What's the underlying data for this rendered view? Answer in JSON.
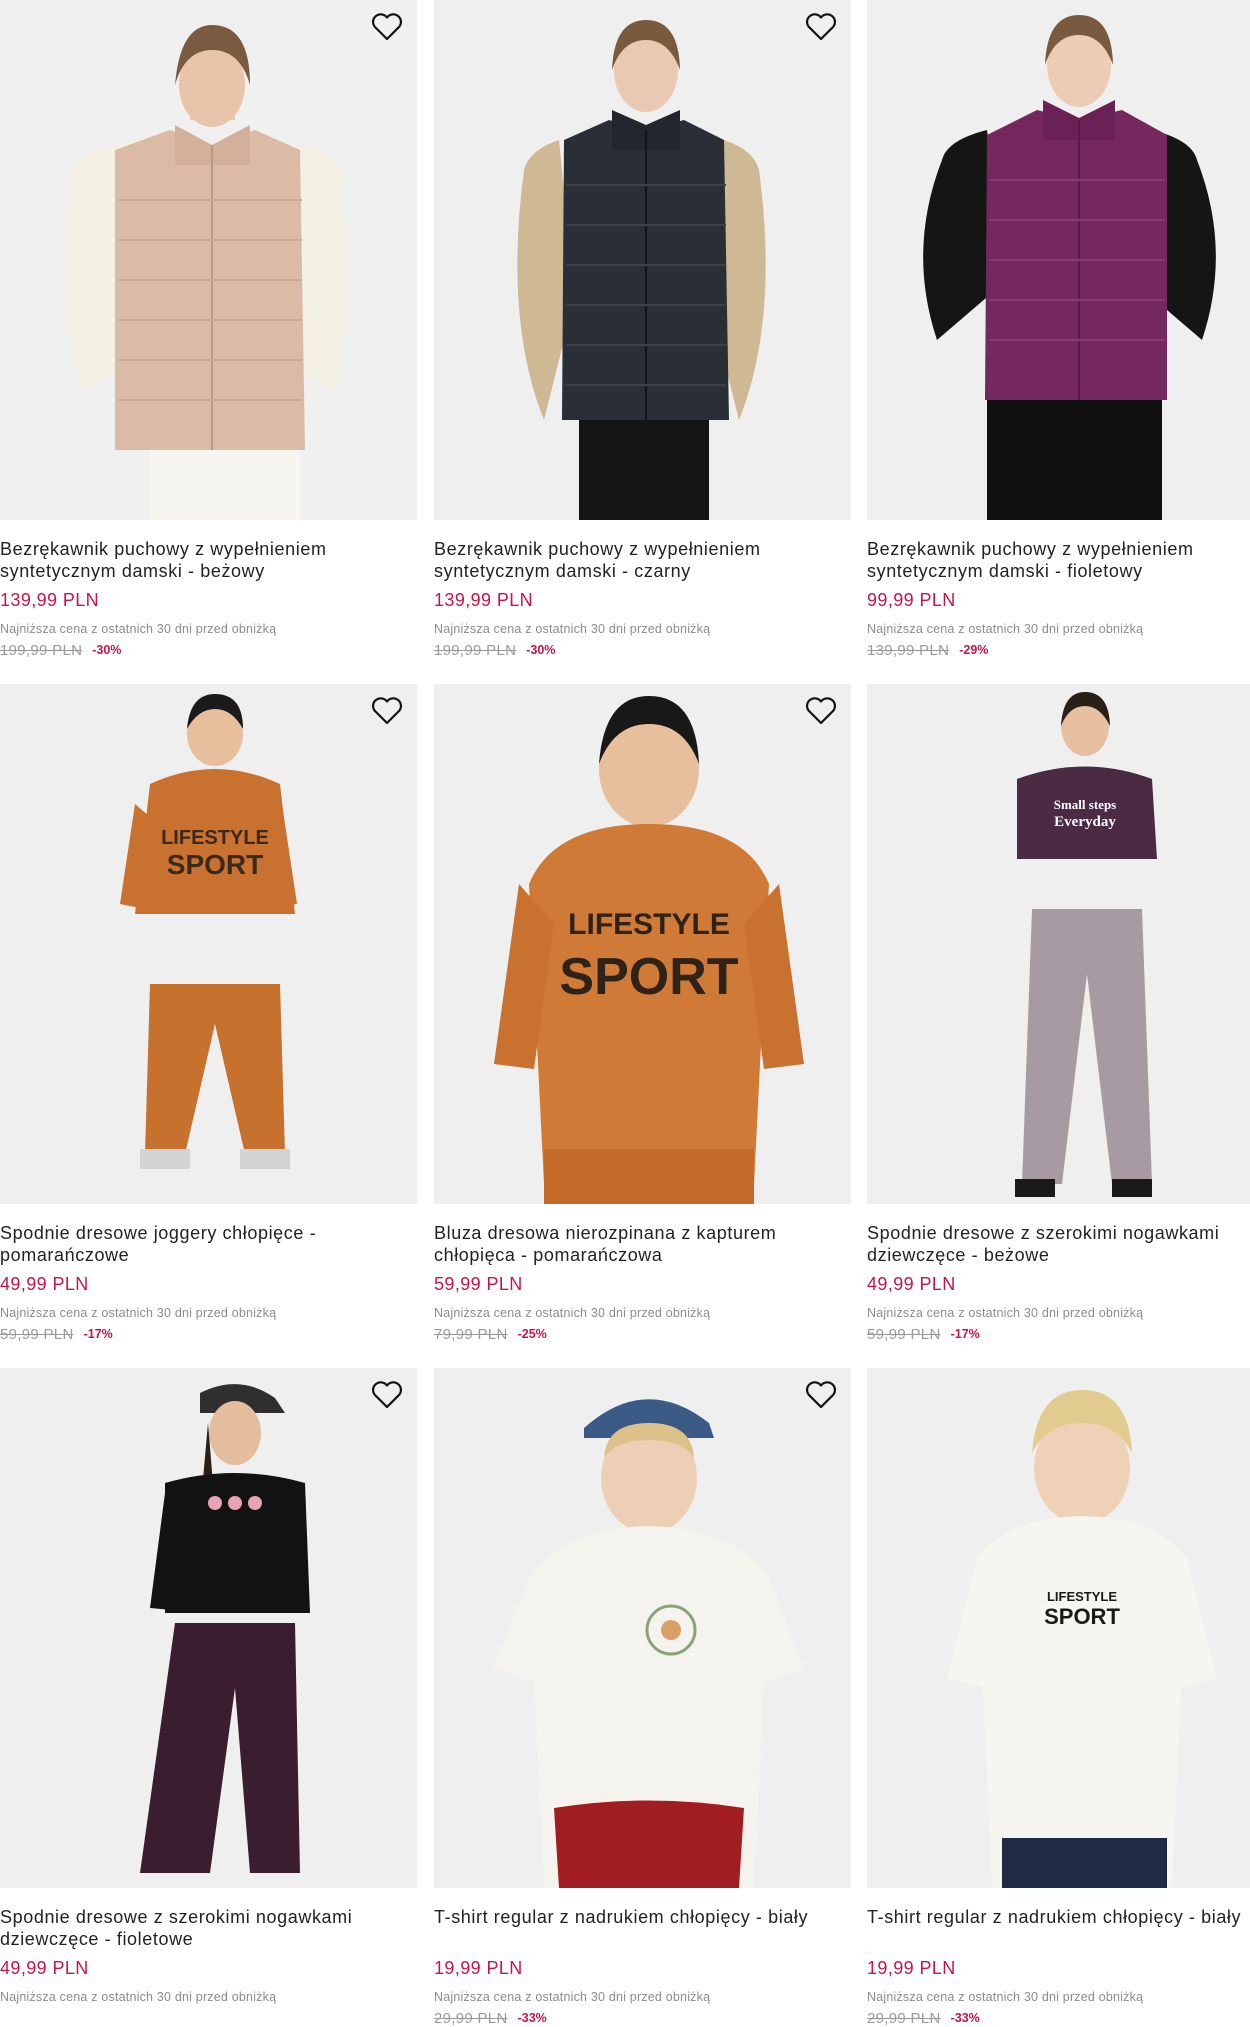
{
  "colors": {
    "accent": "#c4164d",
    "muted": "#8c8c8c",
    "text": "#222222"
  },
  "products": [
    {
      "title": "Bezrękawnik puchowy z wypełnieniem syntetycznym damski - beżowy",
      "price": "139,99 PLN",
      "note": "Najniższa cena z ostatnich 30 dni przed obniżką",
      "old_price": "199,99 PLN",
      "discount": "-30%",
      "icon": "heart-icon"
    },
    {
      "title": "Bezrękawnik puchowy z wypełnieniem syntetycznym damski - czarny",
      "price": "139,99 PLN",
      "note": "Najniższa cena z ostatnich 30 dni przed obniżką",
      "old_price": "199,99 PLN",
      "discount": "-30%",
      "icon": "heart-icon"
    },
    {
      "title": "Bezrękawnik puchowy z wypełnieniem syntetycznym damski - fioletowy",
      "price": "99,99 PLN",
      "note": "Najniższa cena z ostatnich 30 dni przed obniżką",
      "old_price": "139,99 PLN",
      "discount": "-29%",
      "icon": "heart-icon"
    },
    {
      "title": "Spodnie dresowe joggery chłopięce - pomarańczowe",
      "price": "49,99 PLN",
      "note": "Najniższa cena z ostatnich 30 dni przed obniżką",
      "old_price": "59,99 PLN",
      "discount": "-17%",
      "icon": "heart-icon"
    },
    {
      "title": "Bluza dresowa nierozpinana z kapturem chłopięca - pomarańczowa",
      "price": "59,99 PLN",
      "note": "Najniższa cena z ostatnich 30 dni przed obniżką",
      "old_price": "79,99 PLN",
      "discount": "-25%",
      "icon": "heart-icon"
    },
    {
      "title": "Spodnie dresowe z szerokimi nogawkami dziewczęce - beżowe",
      "price": "49,99 PLN",
      "note": "Najniższa cena z ostatnich 30 dni przed obniżką",
      "old_price": "59,99 PLN",
      "discount": "-17%",
      "icon": "heart-icon"
    },
    {
      "title": "Spodnie dresowe z szerokimi nogawkami dziewczęce - fioletowe",
      "price": "49,99 PLN",
      "note": "Najniższa cena z ostatnich 30 dni przed obniżką",
      "old_price": "",
      "discount": "",
      "icon": "heart-icon"
    },
    {
      "title": "T-shirt regular z nadrukiem chłopięcy - biały",
      "price": "19,99 PLN",
      "note": "Najniższa cena z ostatnich 30 dni przed obniżką",
      "old_price": "29,99 PLN",
      "discount": "-33%",
      "icon": "heart-icon"
    },
    {
      "title": "T-shirt regular z nadrukiem chłopięcy - biały",
      "price": "19,99 PLN",
      "note": "Najniższa cena z ostatnich 30 dni przed obniżką",
      "old_price": "29,99 PLN",
      "discount": "-33%",
      "icon": "heart-icon"
    }
  ]
}
